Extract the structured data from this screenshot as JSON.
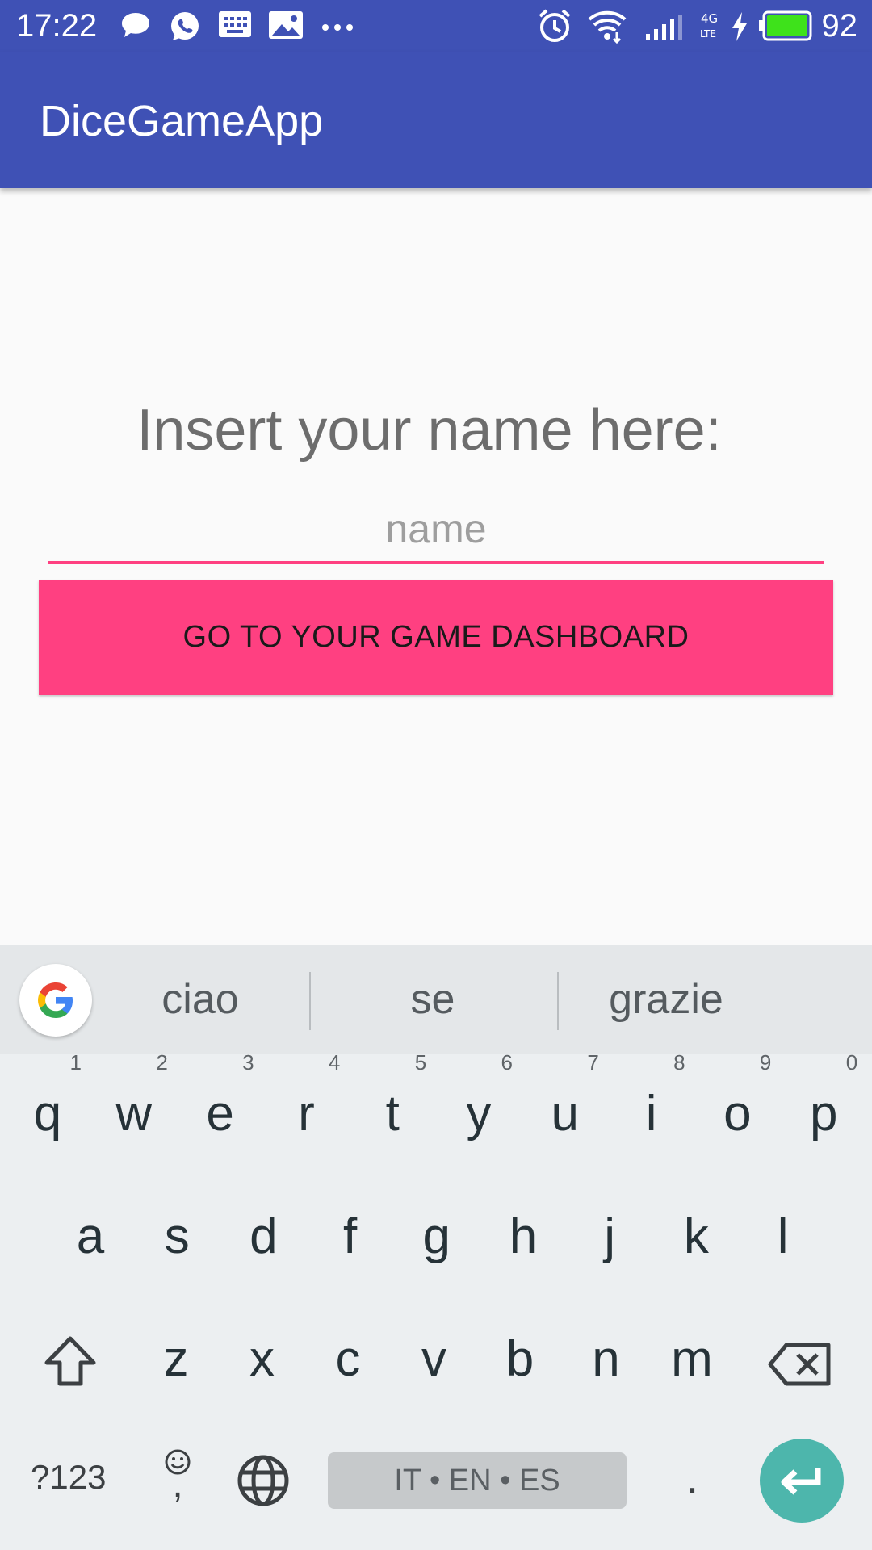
{
  "status_bar": {
    "time": "17:22",
    "battery_percent": "92"
  },
  "app_bar": {
    "title": "DiceGameApp"
  },
  "main": {
    "prompt": "Insert your name here:",
    "name_placeholder": "name",
    "name_value": "",
    "dashboard_button_label": "GO TO YOUR GAME DASHBOARD"
  },
  "keyboard": {
    "suggestions": [
      "ciao",
      "se",
      "grazie"
    ],
    "row1": [
      {
        "key": "q",
        "hint": "1"
      },
      {
        "key": "w",
        "hint": "2"
      },
      {
        "key": "e",
        "hint": "3"
      },
      {
        "key": "r",
        "hint": "4"
      },
      {
        "key": "t",
        "hint": "5"
      },
      {
        "key": "y",
        "hint": "6"
      },
      {
        "key": "u",
        "hint": "7"
      },
      {
        "key": "i",
        "hint": "8"
      },
      {
        "key": "o",
        "hint": "9"
      },
      {
        "key": "p",
        "hint": "0"
      }
    ],
    "row2": [
      "a",
      "s",
      "d",
      "f",
      "g",
      "h",
      "j",
      "k",
      "l"
    ],
    "row3": [
      "z",
      "x",
      "c",
      "v",
      "b",
      "n",
      "m"
    ],
    "symbols_label": "?123",
    "comma_label": ",",
    "space_label": "IT • EN • ES",
    "period_label": "."
  },
  "colors": {
    "primary": "#3f51b5",
    "accent": "#ff4081",
    "enter_key": "#4db6ac"
  }
}
